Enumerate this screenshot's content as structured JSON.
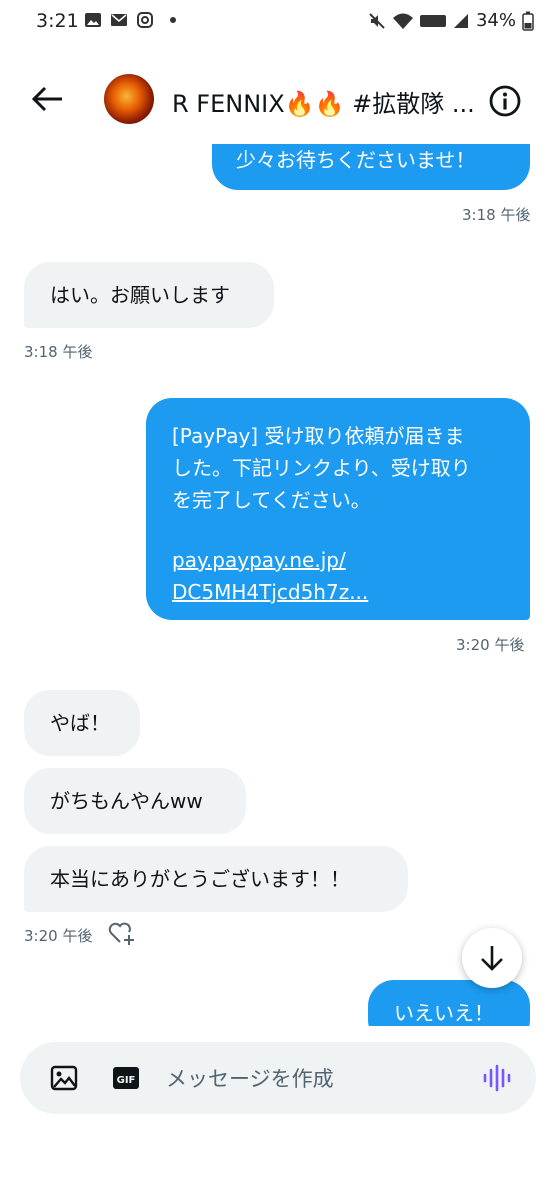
{
  "status_bar": {
    "time": "3:21",
    "battery": "34%"
  },
  "header": {
    "title": "R FENNIX🔥🔥 #拡散隊 ..."
  },
  "messages": [
    {
      "dir": "out",
      "text": "少々お待ちくださいませ！"
    },
    {
      "timestamp": "3:18 午後"
    },
    {
      "dir": "in",
      "text": "はい。お願いします"
    },
    {
      "timestamp": "3:18 午後"
    },
    {
      "dir": "out",
      "lines": [
        "[PayPay] 受け取り依頼が届きま",
        "した。下記リンクより、受け取り",
        "を完了してください。"
      ],
      "link_lines": [
        "pay.paypay.ne.jp/",
        "DC5MH4Tjcd5h7z..."
      ]
    },
    {
      "timestamp": "3:20 午後"
    },
    {
      "dir": "in",
      "text": "やば！"
    },
    {
      "dir": "in",
      "text": "がちもんやんww"
    },
    {
      "dir": "in",
      "text": "本当にありがとうございます！！"
    },
    {
      "timestamp": "3:20 午後"
    },
    {
      "dir": "out",
      "text": "いえいえ！"
    }
  ],
  "composer": {
    "placeholder": "メッセージを作成"
  },
  "icons": {
    "back": "arrow-left-icon",
    "info": "info-icon",
    "scroll": "arrow-down-icon",
    "image": "image-icon",
    "gif": "gif-icon",
    "voice": "voice-waveform-icon",
    "react": "heart-plus-icon"
  },
  "colors": {
    "outgoing_bubble": "#1d9bf0",
    "incoming_bubble": "#eff3f4",
    "voice_accent": "#7856ff"
  }
}
